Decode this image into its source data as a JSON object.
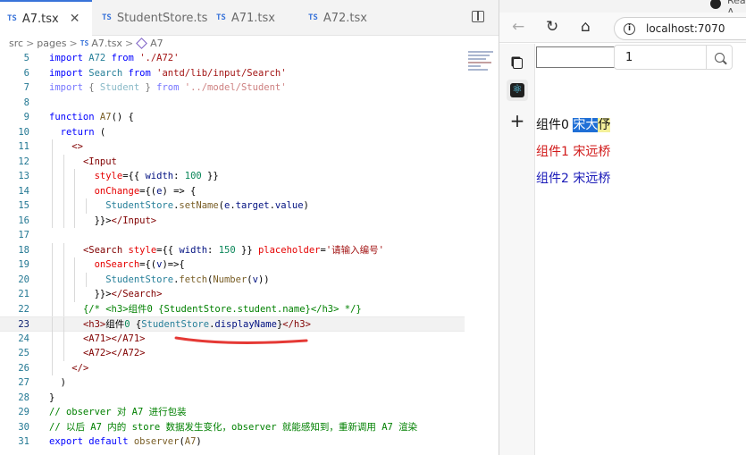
{
  "editor": {
    "tabs": [
      {
        "label": "A7.tsx",
        "active": true,
        "close": "✕"
      },
      {
        "label": "StudentStore.ts",
        "active": false
      },
      {
        "label": "A71.tsx",
        "active": false
      },
      {
        "label": "A72.tsx",
        "active": false
      }
    ],
    "tab_prefix": "TS",
    "breadcrumb": [
      "src",
      "pages",
      "A7.tsx",
      "A7"
    ],
    "breadcrumb_sep": ">",
    "current_line": 23,
    "lines": [
      {
        "n": 5,
        "text": "import A72 from './A72'"
      },
      {
        "n": 6,
        "text": "import Search from 'antd/lib/input/Search'"
      },
      {
        "n": 7,
        "text": "import { Student } from '../model/Student'"
      },
      {
        "n": 8,
        "text": ""
      },
      {
        "n": 9,
        "text": "function A7() {"
      },
      {
        "n": 10,
        "text": "  return ("
      },
      {
        "n": 11,
        "text": "    <>"
      },
      {
        "n": 12,
        "text": "      <Input"
      },
      {
        "n": 13,
        "text": "        style={{ width: 100 }}"
      },
      {
        "n": 14,
        "text": "        onChange={(e) => {"
      },
      {
        "n": 15,
        "text": "          StudentStore.setName(e.target.value)"
      },
      {
        "n": 16,
        "text": "        }}></Input>"
      },
      {
        "n": 17,
        "text": ""
      },
      {
        "n": 18,
        "text": "      <Search style={{ width: 150 }} placeholder='请输入编号'"
      },
      {
        "n": 19,
        "text": "        onSearch={(v)=>{"
      },
      {
        "n": 20,
        "text": "          StudentStore.fetch(Number(v))"
      },
      {
        "n": 21,
        "text": "        }}></Search>"
      },
      {
        "n": 22,
        "text": "      {/* <h3>组件0 {StudentStore.student.name}</h3> */}"
      },
      {
        "n": 23,
        "text": "      <h3>组件0 {StudentStore.displayName}</h3>"
      },
      {
        "n": 24,
        "text": "      <A71></A71>"
      },
      {
        "n": 25,
        "text": "      <A72></A72>"
      },
      {
        "n": 26,
        "text": "    </>"
      },
      {
        "n": 27,
        "text": "  )"
      },
      {
        "n": 28,
        "text": "}"
      },
      {
        "n": 29,
        "text": "// observer 对 A7 进行包装"
      },
      {
        "n": 30,
        "text": "// 以后 A7 内的 store 数据发生变化，observer 就能感知到，重新调用 A7 渲染"
      },
      {
        "n": 31,
        "text": "export default observer(A7)"
      }
    ]
  },
  "browser": {
    "app_tab_label": "React A",
    "address": "localhost:7070",
    "info_glyph": "i",
    "icons": {
      "back": "←",
      "reload": "↻",
      "home": "⌂",
      "add": "+",
      "react": "⚛"
    },
    "page": {
      "input_value": "",
      "search_value": "1",
      "search_placeholder": "请输入编号",
      "headings": [
        {
          "prefix": "组件0 ",
          "name_selected": "宋大",
          "name_cursor": "伃",
          "color": "#111111"
        },
        {
          "text": "组件1 宋远桥",
          "color": "#d11a1a"
        },
        {
          "text": "组件2 宋远桥",
          "color": "#1a1ab8"
        }
      ]
    }
  },
  "colors": {
    "accent": "#3873d9",
    "selection": "#1f6fd6",
    "annotation": "#e53935"
  }
}
